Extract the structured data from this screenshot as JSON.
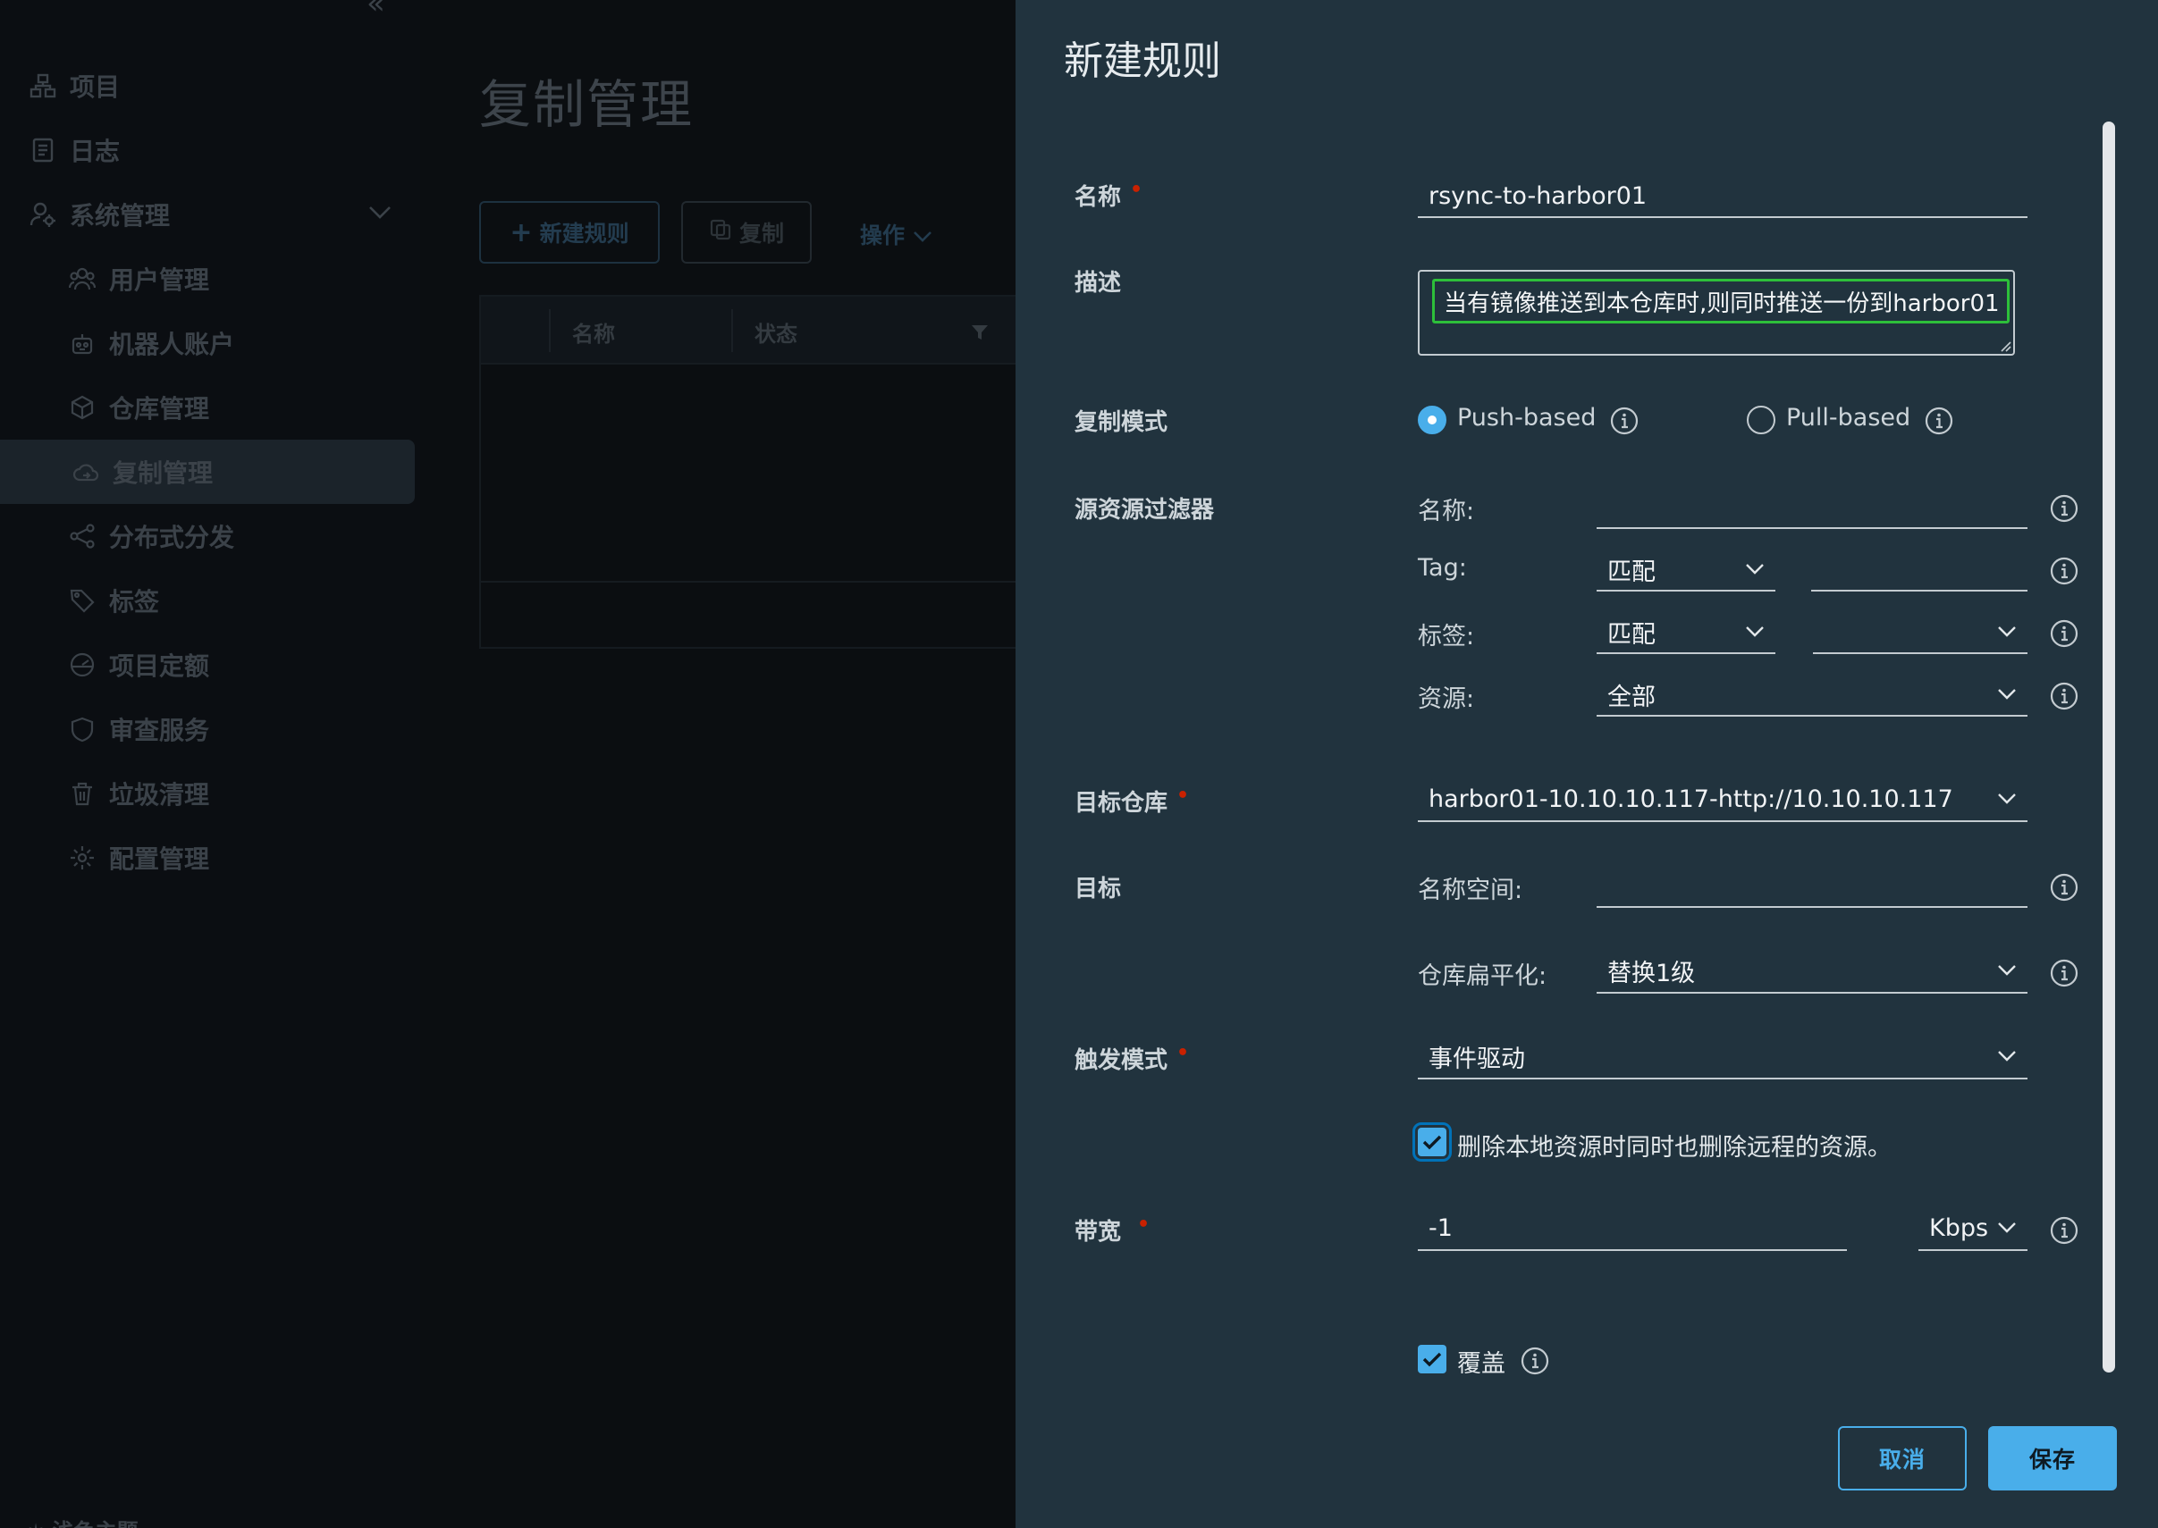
{
  "sidebar": {
    "items": [
      {
        "label": "项目",
        "icon": "project-icon"
      },
      {
        "label": "日志",
        "icon": "log-icon"
      },
      {
        "label": "系统管理",
        "icon": "admin-icon"
      },
      {
        "label": "用户管理",
        "icon": "users-icon"
      },
      {
        "label": "机器人账户",
        "icon": "robot-icon"
      },
      {
        "label": "仓库管理",
        "icon": "cube-icon"
      },
      {
        "label": "复制管理",
        "icon": "cloud-icon"
      },
      {
        "label": "分布式分发",
        "icon": "share-icon"
      },
      {
        "label": "标签",
        "icon": "tag-icon"
      },
      {
        "label": "项目定额",
        "icon": "gauge-icon"
      },
      {
        "label": "审查服务",
        "icon": "shield-icon"
      },
      {
        "label": "垃圾清理",
        "icon": "trash-icon"
      },
      {
        "label": "配置管理",
        "icon": "gear-icon"
      }
    ],
    "bottom_label": "浅色主题"
  },
  "background": {
    "page_title": "复制管理",
    "new_rule_button": "新建规则",
    "copy_button": "复制",
    "actions_link": "操作",
    "table_headers": [
      "名称",
      "状态"
    ]
  },
  "modal": {
    "title": "新建规则",
    "name": {
      "label": "名称",
      "value": "rsync-to-harbor01"
    },
    "description": {
      "label": "描述",
      "value": "当有镜像推送到本仓库时,则同时推送一份到harbor01"
    },
    "replication_mode": {
      "label": "复制模式",
      "push": "Push-based",
      "pull": "Pull-based",
      "selected": "push"
    },
    "source_filter": {
      "label": "源资源过滤器",
      "name_label": "名称:",
      "name_value": "",
      "tag_label": "Tag:",
      "tag_match": "匹配",
      "tag_value": "",
      "label_label": "标签:",
      "label_match": "匹配",
      "label_value": "",
      "resource_label": "资源:",
      "resource_value": "全部"
    },
    "target_registry": {
      "label": "目标仓库",
      "value": "harbor01-10.10.10.117-http://10.10.10.117"
    },
    "target": {
      "label": "目标",
      "namespace_label": "名称空间:",
      "namespace_value": "",
      "flatten_label": "仓库扁平化:",
      "flatten_value": "替换1级"
    },
    "trigger": {
      "label": "触发模式",
      "value": "事件驱动"
    },
    "delete_remote": {
      "label": "删除本地资源时同时也删除远程的资源。",
      "checked": true
    },
    "bandwidth": {
      "label": "带宽",
      "value": "-1",
      "unit": "Kbps"
    },
    "override": {
      "label": "覆盖",
      "checked": true
    },
    "cancel_button": "取消",
    "save_button": "保存"
  },
  "colors": {
    "modal_bg": "#21333e",
    "accent": "#49aeea",
    "required": "#c92100",
    "highlight": "#2dbf3a"
  }
}
